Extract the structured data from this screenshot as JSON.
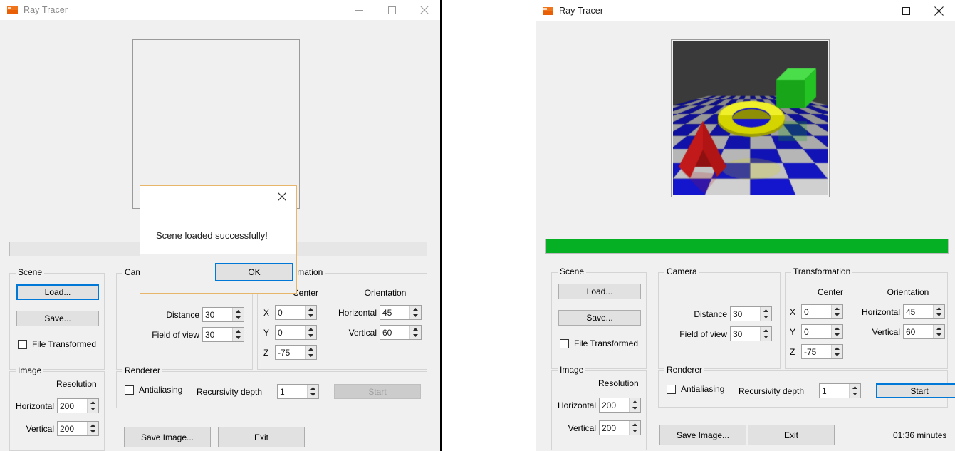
{
  "windows": {
    "left": {
      "title": "Ray Tracer",
      "state": "inactive",
      "titlebar_buttons": {
        "minimize": "minimize-icon",
        "maximize": "maximize-icon",
        "close": "close-icon"
      },
      "image_placeholder": "empty",
      "progress": {
        "percent": 0
      },
      "scene": {
        "group_label": "Scene",
        "load_label": "Load...",
        "save_label": "Save...",
        "file_transformed_label": "File Transformed",
        "file_transformed_checked": false
      },
      "camera": {
        "group_label": "Camera",
        "distance_label": "Distance",
        "distance_value": "30",
        "fov_label": "Field of view",
        "fov_value": "30"
      },
      "transformation": {
        "group_label": "Transformation",
        "center_label": "Center",
        "orientation_label": "Orientation",
        "x_label": "X",
        "x_value": "0",
        "y_label": "Y",
        "y_value": "0",
        "z_label": "Z",
        "z_value": "-75",
        "horizontal_label": "Horizontal",
        "horizontal_value": "45",
        "vertical_label": "Vertical",
        "vertical_value": "60"
      },
      "image": {
        "group_label": "Image",
        "resolution_label": "Resolution",
        "horizontal_label": "Horizontal",
        "horizontal_value": "200",
        "vertical_label": "Vertical",
        "vertical_value": "200"
      },
      "renderer": {
        "group_label": "Renderer",
        "antialiasing_label": "Antialiasing",
        "antialiasing_checked": false,
        "recursivity_label": "Recursivity depth",
        "recursivity_value": "1",
        "start_label": "Start",
        "start_enabled": false
      },
      "actions": {
        "save_image_label": "Save Image...",
        "exit_label": "Exit"
      },
      "dialog": {
        "visible": true,
        "message": "Scene loaded successfully!",
        "ok_label": "OK",
        "close_icon": "close-icon"
      }
    },
    "right": {
      "title": "Ray Tracer",
      "state": "active",
      "titlebar_buttons": {
        "minimize": "minimize-icon",
        "maximize": "maximize-icon",
        "close": "close-icon"
      },
      "progress": {
        "percent": 100,
        "color": "#06b025"
      },
      "scene": {
        "group_label": "Scene",
        "load_label": "Load...",
        "save_label": "Save...",
        "file_transformed_label": "File Transformed",
        "file_transformed_checked": false
      },
      "camera": {
        "group_label": "Camera",
        "distance_label": "Distance",
        "distance_value": "30",
        "fov_label": "Field of view",
        "fov_value": "30"
      },
      "transformation": {
        "group_label": "Transformation",
        "center_label": "Center",
        "orientation_label": "Orientation",
        "x_label": "X",
        "x_value": "0",
        "y_label": "Y",
        "y_value": "0",
        "z_label": "Z",
        "z_value": "-75",
        "horizontal_label": "Horizontal",
        "horizontal_value": "45",
        "vertical_label": "Vertical",
        "vertical_value": "60"
      },
      "image": {
        "group_label": "Image",
        "resolution_label": "Resolution",
        "horizontal_label": "Horizontal",
        "horizontal_value": "200",
        "vertical_label": "Vertical",
        "vertical_value": "200"
      },
      "renderer": {
        "group_label": "Renderer",
        "antialiasing_label": "Antialiasing",
        "antialiasing_checked": false,
        "recursivity_label": "Recursivity depth",
        "recursivity_value": "1",
        "start_label": "Start",
        "start_enabled": true
      },
      "actions": {
        "save_image_label": "Save Image...",
        "exit_label": "Exit"
      },
      "status": {
        "elapsed": "01:36 minutes"
      },
      "render_preview": {
        "description": "ray-traced scene: yellow torus, green cube, red pyramid on blue and white checkered reflective floor",
        "background": "#3a3a3a",
        "floor_colors": [
          "#1616c8",
          "#c8c8c8"
        ],
        "torus_color": "#d4d400",
        "cube_color": "#18c018",
        "pyramid_color": "#b01414"
      }
    }
  },
  "colors": {
    "window_bg": "#f0f0f0",
    "accent_focus": "#0078d7",
    "progress_green": "#06b025",
    "dialog_border": "#e8b66a",
    "title_icon": "#f0751a"
  }
}
